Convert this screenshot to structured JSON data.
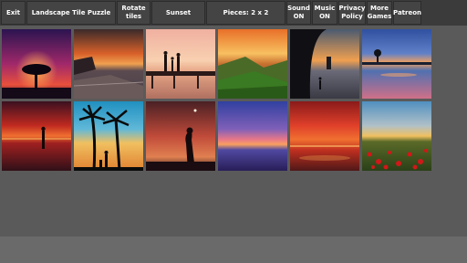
{
  "toolbar": {
    "exit_label": "Exit",
    "title": "Landscape Tile Puzzle",
    "rotate_label": "Rotate\ntiles",
    "category_label": "Sunset",
    "pieces_label": "Pieces: 2 x 2",
    "sound_label": "Sound\nON",
    "music_label": "Music\nON",
    "privacy_label": "Privacy\nPolicy",
    "more_games_label": "More\nGames",
    "patreon_label": "Patreon"
  },
  "colors": {
    "toolbar_bg": "#3b3b3b",
    "button_bg": "#444444",
    "grid_bg": "#5a5a5a",
    "bottom_bg": "#6a6a6a"
  },
  "thumbnails": [
    {
      "subject": "lone tree under purple-red sky"
    },
    {
      "subject": "rocky coast at sunset"
    },
    {
      "subject": "family silhouettes on pier"
    },
    {
      "subject": "green hills at sunset"
    },
    {
      "subject": "cave arch over beach"
    },
    {
      "subject": "tree on island with reflection"
    },
    {
      "subject": "person silhouette at red sea sunset"
    },
    {
      "subject": "palm trees and couple silhouettes"
    },
    {
      "subject": "woman silhouette under red clouds"
    },
    {
      "subject": "purple sky over sea"
    },
    {
      "subject": "red clouds over water"
    },
    {
      "subject": "poppy field under sunset"
    }
  ]
}
